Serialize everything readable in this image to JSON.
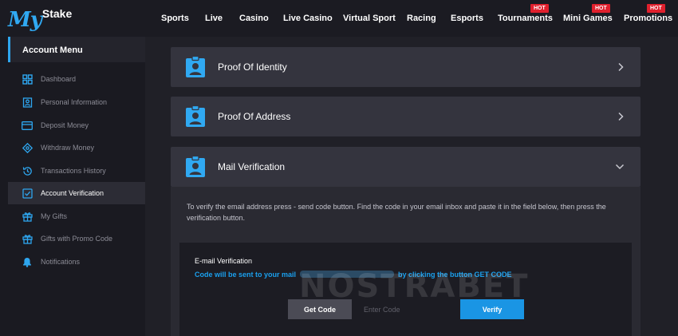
{
  "brand": {
    "logo_main": "My",
    "logo_sub": "Stake"
  },
  "nav": {
    "items": [
      {
        "label": "Sports",
        "hot": false
      },
      {
        "label": "Live",
        "hot": false
      },
      {
        "label": "Casino",
        "hot": false
      },
      {
        "label": "Live Casino",
        "hot": false
      },
      {
        "label": "Virtual Sport",
        "hot": false
      },
      {
        "label": "Racing",
        "hot": false
      },
      {
        "label": "Esports",
        "hot": false
      },
      {
        "label": "Tournaments",
        "hot": true
      },
      {
        "label": "Mini Games",
        "hot": true
      },
      {
        "label": "Promotions",
        "hot": true
      }
    ],
    "hot_label": "HOT"
  },
  "sidebar": {
    "header": "Account Menu",
    "items": [
      {
        "label": "Dashboard",
        "icon": "dashboard-icon",
        "active": false
      },
      {
        "label": "Personal Information",
        "icon": "id-card-icon",
        "active": false
      },
      {
        "label": "Deposit Money",
        "icon": "credit-card-icon",
        "active": false
      },
      {
        "label": "Withdraw Money",
        "icon": "withdraw-icon",
        "active": false
      },
      {
        "label": "Transactions History",
        "icon": "history-icon",
        "active": false
      },
      {
        "label": "Account Verification",
        "icon": "checkbox-icon",
        "active": true
      },
      {
        "label": "My Gifts",
        "icon": "gift-icon",
        "active": false
      },
      {
        "label": "Gifts with Promo Code",
        "icon": "gift-code-icon",
        "active": false
      },
      {
        "label": "Notifications",
        "icon": "bell-icon",
        "active": false
      }
    ]
  },
  "main": {
    "panels": [
      {
        "title": "Proof Of Identity",
        "icon": "id-badge-icon",
        "expanded": false
      },
      {
        "title": "Proof Of Address",
        "icon": "id-badge-icon",
        "expanded": false
      },
      {
        "title": "Mail Verification",
        "icon": "id-badge-icon",
        "expanded": true
      }
    ],
    "mail": {
      "description": "To verify the email address press - send code button. Find the code in your email inbox and paste it in the field below, then press the verification button.",
      "box_title": "E-mail Verification",
      "send_prefix": "Code will be sent to your mail",
      "send_suffix": "by clicking the button GET CODE",
      "get_code_label": "Get Code",
      "code_placeholder": "Enter Code",
      "verify_label": "Verify"
    }
  },
  "watermark": "NOSTRABET",
  "colors": {
    "accent": "#2ea6ef",
    "background": "#202027",
    "panel": "#34343e",
    "hot": "#e0202d",
    "verify_button": "#1a95e4"
  }
}
